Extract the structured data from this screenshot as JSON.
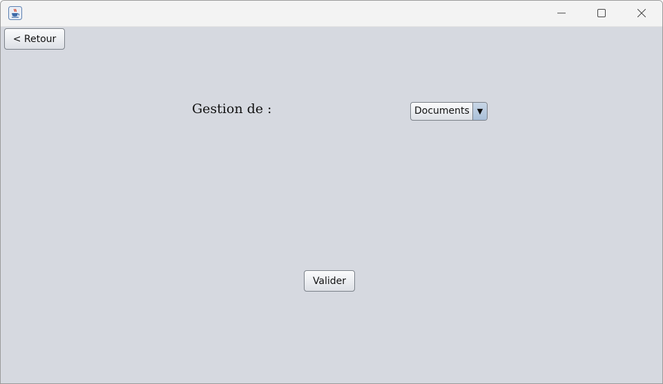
{
  "window": {
    "icons": {
      "app": "java-coffee-cup-icon",
      "minimize": "minimize-icon",
      "maximize": "maximize-icon",
      "close": "close-icon"
    }
  },
  "toolbar": {
    "back_label": "< Retour"
  },
  "form": {
    "gestion_label": "Gestion de :",
    "type_select": {
      "selected": "Documents",
      "arrow_glyph": "▼"
    },
    "submit_label": "Valider"
  },
  "colors": {
    "background": "#d6d9e0",
    "titlebar": "#f3f3f3",
    "combo_arrow": "#a9bfd8"
  }
}
